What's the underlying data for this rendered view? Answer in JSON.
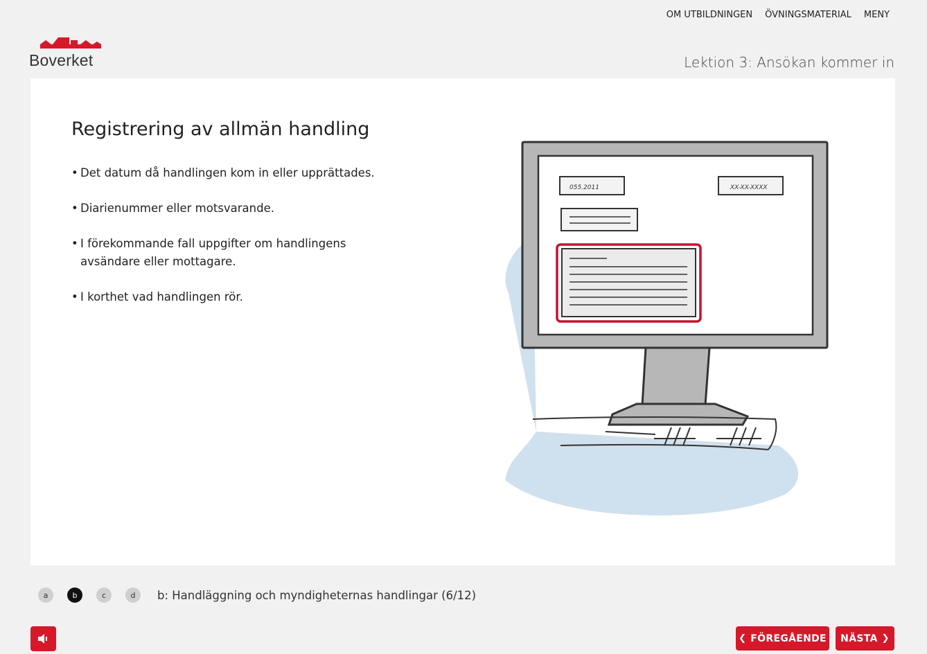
{
  "topnav": {
    "about": "OM UTBILDNINGEN",
    "exercises": "ÖVNINGSMATERIAL",
    "menu": "MENY"
  },
  "logo": {
    "text": "Boverket",
    "color": "#d7182a"
  },
  "lesson": {
    "title": "Lektion 3: Ansökan kommer in"
  },
  "slide": {
    "title": "Registrering av allmän handling",
    "bullets": [
      "Det datum då handlingen kom in eller upprättades.",
      "Diarienummer eller motsvarande.",
      "I förekommande fall uppgifter om handlingens avsändare eller mottagare.",
      "I korthet vad handlingen rör."
    ],
    "illustration": {
      "field_left": "055.2011",
      "field_right": "XX-XX-XXXX"
    }
  },
  "steps": {
    "items": [
      "a",
      "b",
      "c",
      "d"
    ],
    "active": "b",
    "caption": "b: Handläggning och myndigheternas handlingar (6/12)"
  },
  "nav": {
    "prev_label": "FÖREGÅENDE",
    "next_label": "NÄSTA",
    "prev_icon": "chevron-left-icon",
    "next_icon": "chevron-right-icon",
    "audio_icon": "speaker-icon"
  },
  "colors": {
    "accent": "#d7182a",
    "background": "#f1f1f1",
    "panel": "#ffffff",
    "illustration_blue": "#cfe0ee"
  }
}
